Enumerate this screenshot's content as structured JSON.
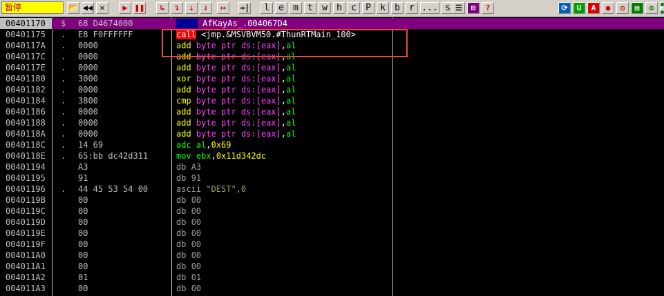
{
  "toolbar": {
    "status": "暂停",
    "buttons": [
      {
        "name": "open-icon",
        "glyph": "📂",
        "style": ""
      },
      {
        "name": "restart-icon",
        "glyph": "◀◀",
        "style": ""
      },
      {
        "name": "close-icon",
        "glyph": "✕",
        "style": ""
      },
      {
        "name": "run-icon",
        "glyph": "▶",
        "style": "red"
      },
      {
        "name": "pause-icon",
        "glyph": "❚❚",
        "style": "red"
      },
      {
        "name": "step-into-icon",
        "glyph": "↳",
        "style": "red"
      },
      {
        "name": "step-over-icon",
        "glyph": "↴",
        "style": "red"
      },
      {
        "name": "trace-into-icon",
        "glyph": "⇣",
        "style": "red"
      },
      {
        "name": "trace-over-icon",
        "glyph": "⇃",
        "style": "red"
      },
      {
        "name": "execute-till-return-icon",
        "glyph": "↦",
        "style": "red"
      },
      {
        "name": "goto-icon",
        "glyph": "→|",
        "style": ""
      }
    ],
    "letters": [
      "l",
      "e",
      "m",
      "t",
      "w",
      "h",
      "c",
      "P",
      "k",
      "b",
      "r",
      "...",
      "s"
    ],
    "right_icons": [
      {
        "name": "list-icon",
        "glyph": "☰",
        "bg": "#d4d0c8",
        "fg": "#000000"
      },
      {
        "name": "grid-icon",
        "glyph": "⊞",
        "bg": "#800080",
        "fg": "#ffffff"
      },
      {
        "name": "help-icon",
        "glyph": "?",
        "bg": "#d4d0c8",
        "fg": "#c00000"
      },
      {
        "name": "refresh-icon",
        "glyph": "⟳",
        "bg": "#0060c0",
        "fg": "#ffffff"
      },
      {
        "name": "plugin-u-icon",
        "glyph": "U",
        "bg": "#00a000",
        "fg": "#ffffff"
      },
      {
        "name": "plugin-a-icon",
        "glyph": "A",
        "bg": "#e00000",
        "fg": "#ffffff"
      },
      {
        "name": "record-icon",
        "glyph": "●",
        "bg": "#d4d0c8",
        "fg": "#e00000"
      },
      {
        "name": "target-icon",
        "glyph": "◎",
        "bg": "#d4d0c8",
        "fg": "#c00000"
      },
      {
        "name": "script-icon",
        "glyph": "▤",
        "bg": "#008000",
        "fg": "#ffffff"
      },
      {
        "name": "tool-icon",
        "glyph": "⚙",
        "bg": "#d4d0c8",
        "fg": "#006000"
      },
      {
        "name": "settings-icon",
        "glyph": "▦",
        "bg": "#008000",
        "fg": "#ffffff"
      }
    ]
  },
  "disasm": {
    "rows": [
      {
        "addr": "00401170",
        "mark": "$",
        "hex": "68 D4674000",
        "mnem": "push",
        "ops": [
          {
            "t": "AfKayAs_.004067D4",
            "c": "plain"
          }
        ],
        "mstyle": "push",
        "selected": true
      },
      {
        "addr": "00401175",
        "mark": ".",
        "hex": "E8 F0FFFFFF",
        "mnem": "call",
        "ops": [
          {
            "t": "<jmp.&MSVBVM50.#ThunRTMain_100>",
            "c": "plain"
          }
        ],
        "mstyle": "call"
      },
      {
        "addr": "0040117A",
        "mark": ".",
        "hex": "0000",
        "mnem": "add",
        "ops": [
          {
            "t": "byte ptr ds:[eax]",
            "c": "mag"
          },
          {
            "t": ",",
            "c": "plain"
          },
          {
            "t": "al",
            "c": "green"
          }
        ],
        "mstyle": "yellow"
      },
      {
        "addr": "0040117C",
        "mark": ".",
        "hex": "0000",
        "mnem": "add",
        "ops": [
          {
            "t": "byte ptr ds:[eax]",
            "c": "mag"
          },
          {
            "t": ",",
            "c": "plain"
          },
          {
            "t": "al",
            "c": "green"
          }
        ],
        "mstyle": "yellow"
      },
      {
        "addr": "0040117E",
        "mark": ".",
        "hex": "0000",
        "mnem": "add",
        "ops": [
          {
            "t": "byte ptr ds:[eax]",
            "c": "mag"
          },
          {
            "t": ",",
            "c": "plain"
          },
          {
            "t": "al",
            "c": "green"
          }
        ],
        "mstyle": "yellow"
      },
      {
        "addr": "00401180",
        "mark": ".",
        "hex": "3000",
        "mnem": "xor",
        "ops": [
          {
            "t": "byte ptr ds:[eax]",
            "c": "mag"
          },
          {
            "t": ",",
            "c": "plain"
          },
          {
            "t": "al",
            "c": "green"
          }
        ],
        "mstyle": "yellow"
      },
      {
        "addr": "00401182",
        "mark": ".",
        "hex": "0000",
        "mnem": "add",
        "ops": [
          {
            "t": "byte ptr ds:[eax]",
            "c": "mag"
          },
          {
            "t": ",",
            "c": "plain"
          },
          {
            "t": "al",
            "c": "green"
          }
        ],
        "mstyle": "yellow"
      },
      {
        "addr": "00401184",
        "mark": ".",
        "hex": "3800",
        "mnem": "cmp",
        "ops": [
          {
            "t": "byte ptr ds:[eax]",
            "c": "mag"
          },
          {
            "t": ",",
            "c": "plain"
          },
          {
            "t": "al",
            "c": "green"
          }
        ],
        "mstyle": "yellow"
      },
      {
        "addr": "00401186",
        "mark": ".",
        "hex": "0000",
        "mnem": "add",
        "ops": [
          {
            "t": "byte ptr ds:[eax]",
            "c": "mag"
          },
          {
            "t": ",",
            "c": "plain"
          },
          {
            "t": "al",
            "c": "green"
          }
        ],
        "mstyle": "yellow"
      },
      {
        "addr": "00401188",
        "mark": ".",
        "hex": "0000",
        "mnem": "add",
        "ops": [
          {
            "t": "byte ptr ds:[eax]",
            "c": "mag"
          },
          {
            "t": ",",
            "c": "plain"
          },
          {
            "t": "al",
            "c": "green"
          }
        ],
        "mstyle": "yellow"
      },
      {
        "addr": "0040118A",
        "mark": ".",
        "hex": "0000",
        "mnem": "add",
        "ops": [
          {
            "t": "byte ptr ds:[eax]",
            "c": "mag"
          },
          {
            "t": ",",
            "c": "plain"
          },
          {
            "t": "al",
            "c": "green"
          }
        ],
        "mstyle": "yellow"
      },
      {
        "addr": "0040118C",
        "mark": ".",
        "hex": "14 69",
        "mnem": "adc",
        "ops": [
          {
            "t": "al",
            "c": "green"
          },
          {
            "t": ",",
            "c": "plain"
          },
          {
            "t": "0x69",
            "c": "yellow"
          }
        ],
        "mstyle": "green"
      },
      {
        "addr": "0040118E",
        "mark": ".",
        "hex": "65:bb dc42d311",
        "mnem": "mov",
        "ops": [
          {
            "t": "ebx",
            "c": "green"
          },
          {
            "t": ",",
            "c": "plain"
          },
          {
            "t": "0x11d342dc",
            "c": "yellow"
          }
        ],
        "mstyle": "green"
      },
      {
        "addr": "00401194",
        "mark": "",
        "hex": "A3",
        "mnem": "db",
        "ops": [
          {
            "t": "A3",
            "c": "db"
          }
        ],
        "mstyle": "db"
      },
      {
        "addr": "00401195",
        "mark": "",
        "hex": "91",
        "mnem": "db",
        "ops": [
          {
            "t": "91",
            "c": "db"
          }
        ],
        "mstyle": "db"
      },
      {
        "addr": "00401196",
        "mark": ".",
        "hex": "44 45 53 54 00",
        "mnem": "ascii",
        "ops": [
          {
            "t": "\"DEST\",0",
            "c": "ascii"
          }
        ],
        "mstyle": "ascii"
      },
      {
        "addr": "0040119B",
        "mark": "",
        "hex": "00",
        "mnem": "db",
        "ops": [
          {
            "t": "00",
            "c": "db"
          }
        ],
        "mstyle": "db"
      },
      {
        "addr": "0040119C",
        "mark": "",
        "hex": "00",
        "mnem": "db",
        "ops": [
          {
            "t": "00",
            "c": "db"
          }
        ],
        "mstyle": "db"
      },
      {
        "addr": "0040119D",
        "mark": "",
        "hex": "00",
        "mnem": "db",
        "ops": [
          {
            "t": "00",
            "c": "db"
          }
        ],
        "mstyle": "db"
      },
      {
        "addr": "0040119E",
        "mark": "",
        "hex": "00",
        "mnem": "db",
        "ops": [
          {
            "t": "00",
            "c": "db"
          }
        ],
        "mstyle": "db"
      },
      {
        "addr": "0040119F",
        "mark": "",
        "hex": "00",
        "mnem": "db",
        "ops": [
          {
            "t": "00",
            "c": "db"
          }
        ],
        "mstyle": "db"
      },
      {
        "addr": "004011A0",
        "mark": "",
        "hex": "00",
        "mnem": "db",
        "ops": [
          {
            "t": "00",
            "c": "db"
          }
        ],
        "mstyle": "db"
      },
      {
        "addr": "004011A1",
        "mark": "",
        "hex": "00",
        "mnem": "db",
        "ops": [
          {
            "t": "00",
            "c": "db"
          }
        ],
        "mstyle": "db"
      },
      {
        "addr": "004011A2",
        "mark": "",
        "hex": "01",
        "mnem": "db",
        "ops": [
          {
            "t": "01",
            "c": "db"
          }
        ],
        "mstyle": "db"
      },
      {
        "addr": "004011A3",
        "mark": "",
        "hex": "00",
        "mnem": "db",
        "ops": [
          {
            "t": "00",
            "c": "db"
          }
        ],
        "mstyle": "db"
      }
    ]
  },
  "colors": {
    "selected_row": "#800080",
    "highlight_box": "#e74c3c",
    "operand_memory": "#ff40ff",
    "mnemonic": "#ffff00"
  }
}
